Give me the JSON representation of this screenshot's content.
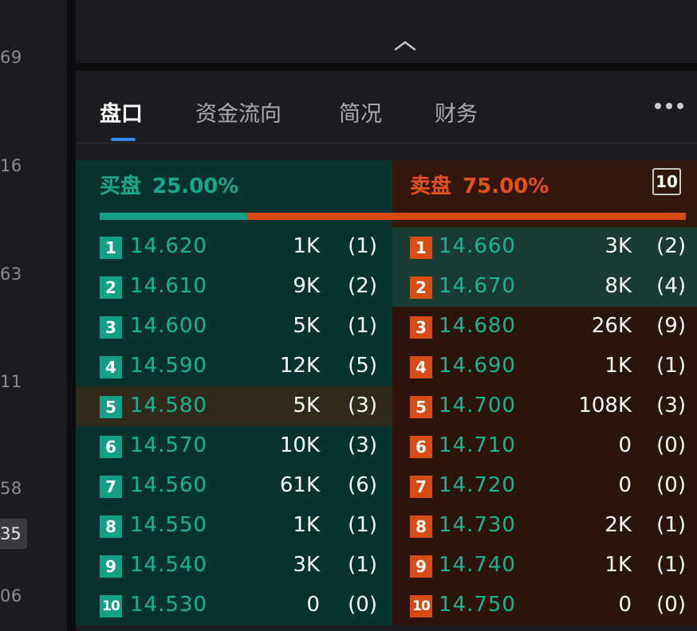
{
  "gutter": {
    "labels": [
      "69",
      "16",
      "63",
      "11",
      "58"
    ],
    "badge": "35",
    "bottom_label": "06"
  },
  "tabs": [
    {
      "label": "盘口",
      "active": true
    },
    {
      "label": "资金流向",
      "active": false
    },
    {
      "label": "简况",
      "active": false
    },
    {
      "label": "财务",
      "active": false
    }
  ],
  "bid_header": {
    "label": "买盘",
    "pct": "25.00%"
  },
  "ask_header": {
    "label": "卖盘",
    "pct": "75.00%"
  },
  "depth_level": "10",
  "ratio": {
    "bid_fraction": 0.25,
    "ask_fraction": 0.75
  },
  "colors": {
    "bid": "#13a088",
    "ask": "#d84b12",
    "bid_bg": "#06332e",
    "ask_bg": "#2a140b",
    "active_tab": "#2f8cff"
  },
  "bids": [
    {
      "level": "1",
      "price": "14.620",
      "volume": "1K",
      "count": "(1)"
    },
    {
      "level": "2",
      "price": "14.610",
      "volume": "9K",
      "count": "(2)"
    },
    {
      "level": "3",
      "price": "14.600",
      "volume": "5K",
      "count": "(1)"
    },
    {
      "level": "4",
      "price": "14.590",
      "volume": "12K",
      "count": "(5)"
    },
    {
      "level": "5",
      "price": "14.580",
      "volume": "5K",
      "count": "(3)"
    },
    {
      "level": "6",
      "price": "14.570",
      "volume": "10K",
      "count": "(3)"
    },
    {
      "level": "7",
      "price": "14.560",
      "volume": "61K",
      "count": "(6)"
    },
    {
      "level": "8",
      "price": "14.550",
      "volume": "1K",
      "count": "(1)"
    },
    {
      "level": "9",
      "price": "14.540",
      "volume": "3K",
      "count": "(1)"
    },
    {
      "level": "10",
      "price": "14.530",
      "volume": "0",
      "count": "(0)"
    }
  ],
  "asks": [
    {
      "level": "1",
      "price": "14.660",
      "volume": "3K",
      "count": "(2)"
    },
    {
      "level": "2",
      "price": "14.670",
      "volume": "8K",
      "count": "(4)"
    },
    {
      "level": "3",
      "price": "14.680",
      "volume": "26K",
      "count": "(9)"
    },
    {
      "level": "4",
      "price": "14.690",
      "volume": "1K",
      "count": "(1)"
    },
    {
      "level": "5",
      "price": "14.700",
      "volume": "108K",
      "count": "(3)"
    },
    {
      "level": "6",
      "price": "14.710",
      "volume": "0",
      "count": "(0)"
    },
    {
      "level": "7",
      "price": "14.720",
      "volume": "0",
      "count": "(0)"
    },
    {
      "level": "8",
      "price": "14.730",
      "volume": "2K",
      "count": "(1)"
    },
    {
      "level": "9",
      "price": "14.740",
      "volume": "1K",
      "count": "(1)"
    },
    {
      "level": "10",
      "price": "14.750",
      "volume": "0",
      "count": "(0)"
    }
  ],
  "highlights": {
    "bid_levels": [
      "5"
    ],
    "ask_levels": [
      "1",
      "2"
    ]
  }
}
